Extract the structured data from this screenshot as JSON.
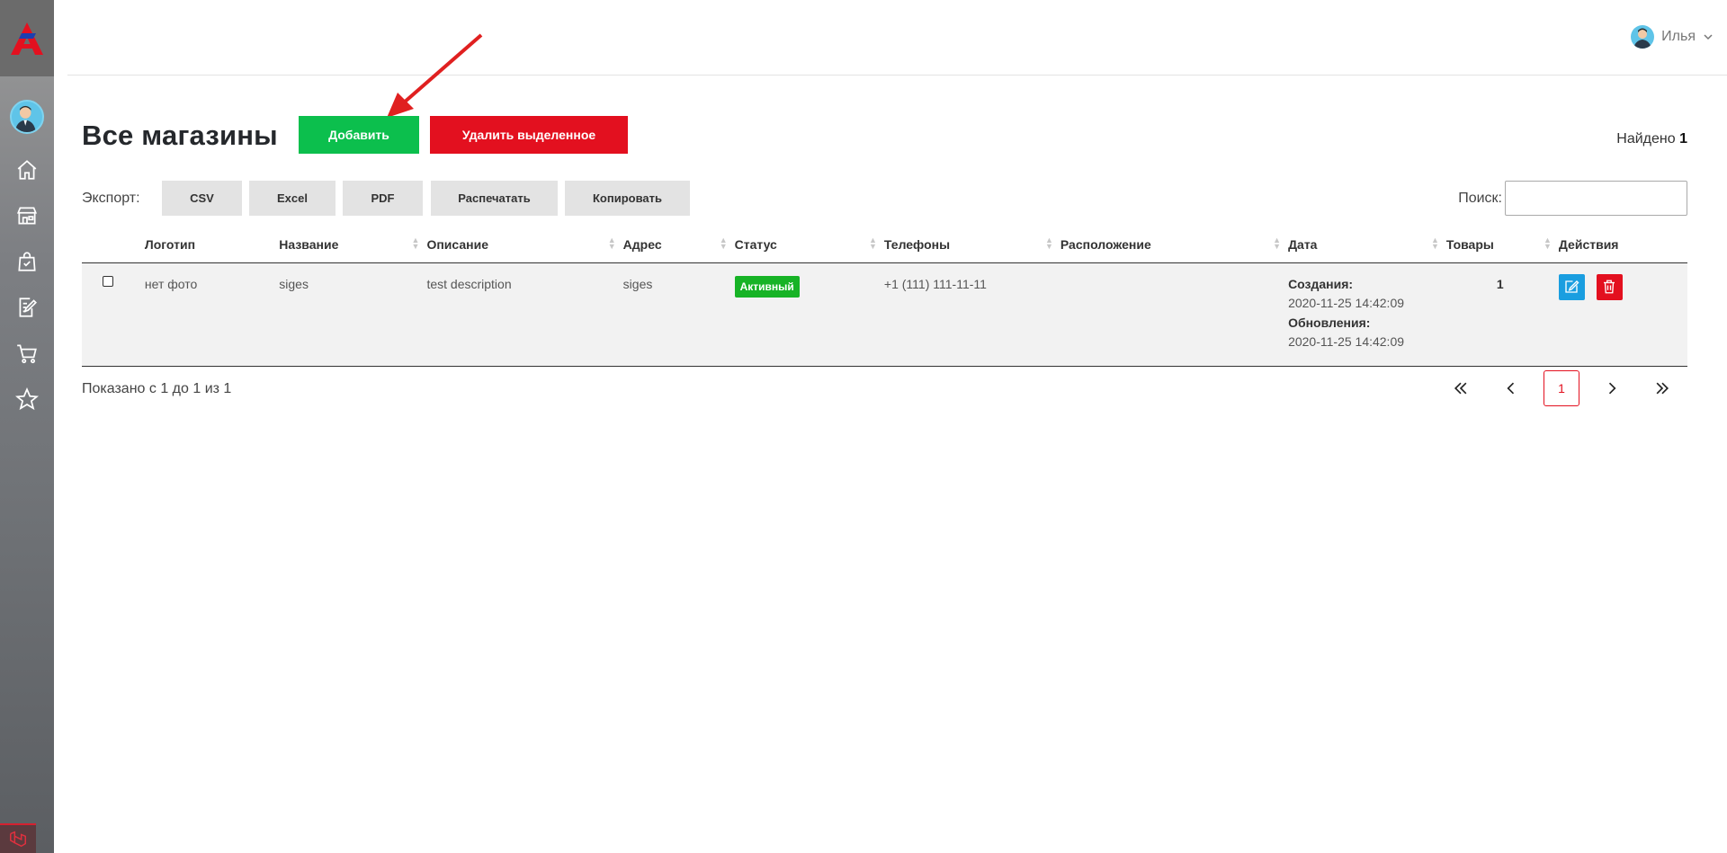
{
  "colors": {
    "accent_green": "#0cbf4d",
    "accent_red": "#e3101f",
    "status_green": "#17b326",
    "edit_blue": "#1a9ee0"
  },
  "sidebar": {
    "logo_icon": "brand-logo-icon",
    "items": [
      {
        "icon": "home-icon"
      },
      {
        "icon": "store-icon"
      },
      {
        "icon": "shopping-bag-icon"
      },
      {
        "icon": "edit-document-icon"
      },
      {
        "icon": "cart-icon"
      },
      {
        "icon": "star-icon"
      }
    ]
  },
  "topbar": {
    "user_name": "Илья"
  },
  "page": {
    "title": "Все магазины",
    "add_label": "Добавить",
    "delete_selected_label": "Удалить выделенное",
    "found_label": "Найдено",
    "found_count": "1"
  },
  "export": {
    "label": "Экспорт:",
    "buttons": [
      "CSV",
      "Excel",
      "PDF",
      "Распечатать",
      "Копировать"
    ],
    "search_label": "Поиск:"
  },
  "table": {
    "columns": [
      "Логотип",
      "Название",
      "Описание",
      "Адрес",
      "Статус",
      "Телефоны",
      "Расположение",
      "Дата",
      "Товары",
      "Действия"
    ],
    "rows": [
      {
        "logo": "нет фото",
        "name": "siges",
        "description": "test description",
        "address": "siges",
        "status": "Активный",
        "phones": "+1 (111) 111-11-11",
        "location": "",
        "created_label": "Создания:",
        "created": "2020-11-25 14:42:09",
        "updated_label": "Обновления:",
        "updated": "2020-11-25 14:42:09",
        "products": "1"
      }
    ]
  },
  "footer": {
    "shown_text": "Показано с 1 до 1 из 1",
    "current_page": "1"
  }
}
